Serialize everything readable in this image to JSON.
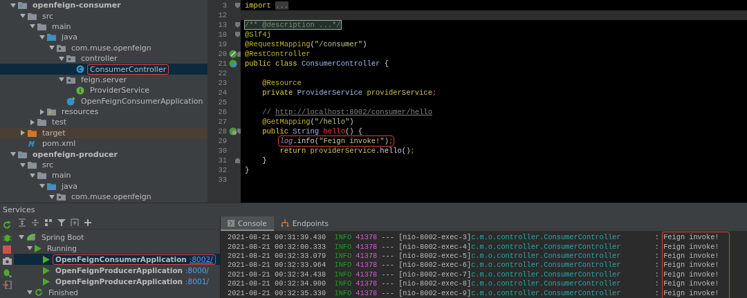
{
  "project_tree": [
    {
      "label": "openfeign-consumer",
      "kind": "module",
      "expanded": true,
      "selected": false,
      "highlighted": false,
      "children": [
        {
          "label": "src",
          "kind": "folder",
          "expanded": true,
          "selected": false,
          "highlighted": false,
          "children": [
            {
              "label": "main",
              "kind": "folder",
              "expanded": true,
              "selected": false,
              "highlighted": false,
              "children": [
                {
                  "label": "java",
                  "kind": "source-folder",
                  "expanded": true,
                  "selected": false,
                  "highlighted": false,
                  "children": [
                    {
                      "label": "com.muse.openfeign",
                      "kind": "package",
                      "expanded": true,
                      "selected": false,
                      "highlighted": false,
                      "children": [
                        {
                          "label": "controller",
                          "kind": "package",
                          "expanded": true,
                          "selected": false,
                          "highlighted": false,
                          "children": [
                            {
                              "label": "ConsumerController",
                              "kind": "class",
                              "selected": true,
                              "highlighted": true
                            }
                          ]
                        },
                        {
                          "label": "feign.server",
                          "kind": "package",
                          "expanded": true,
                          "selected": false,
                          "highlighted": false,
                          "children": [
                            {
                              "label": "ProviderService",
                              "kind": "interface",
                              "selected": false,
                              "highlighted": false
                            }
                          ]
                        },
                        {
                          "label": "OpenFeignConsumerApplication",
                          "kind": "app-class",
                          "selected": false,
                          "highlighted": false
                        }
                      ]
                    }
                  ]
                },
                {
                  "label": "resources",
                  "kind": "resources-folder",
                  "expanded": false,
                  "selected": false,
                  "highlighted": false
                }
              ]
            },
            {
              "label": "test",
              "kind": "folder",
              "expanded": false,
              "selected": false,
              "highlighted": false
            }
          ]
        },
        {
          "label": "target",
          "kind": "excluded-folder",
          "expanded": false,
          "selected": false,
          "highlighted": false
        },
        {
          "label": "pom.xml",
          "kind": "maven",
          "selected": false,
          "highlighted": false
        }
      ]
    },
    {
      "label": "openfeign-producer",
      "kind": "module",
      "expanded": true,
      "selected": false,
      "highlighted": false,
      "children": [
        {
          "label": "src",
          "kind": "folder",
          "expanded": true,
          "selected": false,
          "highlighted": false,
          "children": [
            {
              "label": "main",
              "kind": "folder",
              "expanded": true,
              "selected": false,
              "highlighted": false,
              "children": [
                {
                  "label": "java",
                  "kind": "source-folder",
                  "expanded": true,
                  "selected": false,
                  "highlighted": false,
                  "children": [
                    {
                      "label": "com.muse.openfeign",
                      "kind": "package",
                      "expanded": true,
                      "selected": false,
                      "highlighted": false
                    }
                  ]
                }
              ]
            }
          ]
        }
      ]
    }
  ],
  "editor": {
    "lines": [
      {
        "number": "3",
        "fold_start": true,
        "tokens": [
          {
            "kind": "keyword",
            "text": "import "
          },
          {
            "kind": "folded",
            "text": "..."
          }
        ]
      },
      {
        "number": "12",
        "band": true
      },
      {
        "number": "13",
        "fold_start": true,
        "tokens": [
          {
            "kind": "folded-comment",
            "text": "/** @description ...*/"
          }
        ]
      },
      {
        "number": "18",
        "fold_start": true,
        "tokens": [
          {
            "kind": "annotation",
            "text": "@Slf4j"
          }
        ]
      },
      {
        "number": "19",
        "tokens": [
          {
            "kind": "annotation",
            "text": "@RequestMapping"
          },
          {
            "kind": "plain",
            "text": "("
          },
          {
            "kind": "string",
            "text": "\"/consumer\""
          },
          {
            "kind": "plain",
            "text": ")"
          }
        ]
      },
      {
        "number": "20",
        "fold_end": true,
        "kind": "bean",
        "tokens": [
          {
            "kind": "annotation",
            "text": "@RestController"
          }
        ]
      },
      {
        "number": "21",
        "kind": "bean-class",
        "tokens": [
          {
            "kind": "keyword",
            "text": "public class "
          },
          {
            "kind": "type",
            "text": "ConsumerController "
          },
          {
            "kind": "plain",
            "text": "{"
          }
        ]
      },
      {
        "number": "22"
      },
      {
        "number": "23",
        "tokens": [
          {
            "kind": "annotation",
            "text": "    @Resource"
          }
        ]
      },
      {
        "number": "24",
        "tokens": [
          {
            "kind": "keyword",
            "text": "    private "
          },
          {
            "kind": "type",
            "text": "ProviderService "
          },
          {
            "kind": "field",
            "text": "providerService"
          },
          {
            "kind": "punct",
            "text": ";"
          }
        ]
      },
      {
        "number": "25"
      },
      {
        "number": "26",
        "tokens": [
          {
            "kind": "comment",
            "text": "    // "
          },
          {
            "kind": "link",
            "text": "http://localhost:8002/consumer/hello"
          }
        ]
      },
      {
        "number": "27",
        "tokens": [
          {
            "kind": "annotation",
            "text": "    @GetMapping"
          },
          {
            "kind": "plain",
            "text": "("
          },
          {
            "kind": "string",
            "text": "\"/hello\""
          },
          {
            "kind": "plain",
            "text": ")"
          }
        ]
      },
      {
        "number": "28",
        "fold_start": true,
        "kind": "bean-web",
        "tokens": [
          {
            "kind": "keyword",
            "text": "    public "
          },
          {
            "kind": "type",
            "text": "String "
          },
          {
            "kind": "method",
            "text": "hello"
          },
          {
            "kind": "plain",
            "text": "() {"
          }
        ]
      },
      {
        "number": "29",
        "highlighted": true,
        "tokens": [
          {
            "kind": "static",
            "text": "log"
          },
          {
            "kind": "plain",
            "text": ".info("
          },
          {
            "kind": "string",
            "text": "\"Feign invoke!\""
          },
          {
            "kind": "plain",
            "text": ")"
          },
          {
            "kind": "punct",
            "text": ";"
          }
        ]
      },
      {
        "number": "30",
        "tokens": [
          {
            "kind": "keyword",
            "text": "        return "
          },
          {
            "kind": "field",
            "text": "providerService"
          },
          {
            "kind": "plain",
            "text": ".hello()"
          },
          {
            "kind": "punct",
            "text": ";"
          }
        ]
      },
      {
        "number": "31",
        "fold_end": true,
        "tokens": [
          {
            "kind": "plain",
            "text": "    }"
          }
        ]
      },
      {
        "number": "32",
        "tokens": [
          {
            "kind": "plain",
            "text": "}"
          }
        ]
      },
      {
        "number": "33"
      }
    ]
  },
  "services": {
    "title": "Services",
    "tree": [
      {
        "label": "Spring Boot",
        "kind": "group",
        "expanded": true,
        "selected": false,
        "highlighted": false,
        "children": [
          {
            "label": "Running",
            "kind": "running",
            "expanded": true,
            "selected": false,
            "highlighted": false,
            "children": [
              {
                "label": "OpenFeignConsumerApplication",
                "port": ":8002/",
                "kind": "app",
                "selected": true,
                "highlighted": true
              },
              {
                "label": "OpenFeignProducerApplication",
                "port": ":8000/",
                "kind": "app",
                "selected": false,
                "highlighted": false
              },
              {
                "label": "OpenFeignProducerApplication",
                "port": ":8001/",
                "kind": "app",
                "selected": false,
                "highlighted": false
              }
            ]
          },
          {
            "label": "Finished",
            "kind": "finished",
            "expanded": true,
            "selected": false,
            "highlighted": false
          }
        ]
      }
    ],
    "tabs": [
      {
        "label": "Console",
        "kind": "console",
        "selected": true
      },
      {
        "label": "Endpoints",
        "kind": "endpoints",
        "selected": false
      }
    ],
    "messages_highlighted": true,
    "log": [
      {
        "time": "2021-08-21 00:31:39.430",
        "level": "INFO",
        "pid": "41378",
        "sep": "---",
        "thread": "[nio-8002-exec-3]",
        "logger": "c.m.o.controller.ConsumerController",
        "colon": ":",
        "message": "Feign invoke!"
      },
      {
        "time": "2021-08-21 00:32:00.333",
        "level": "INFO",
        "pid": "41378",
        "sep": "---",
        "thread": "[nio-8002-exec-4]",
        "logger": "c.m.o.controller.ConsumerController",
        "colon": ":",
        "message": "Feign invoke!"
      },
      {
        "time": "2021-08-21 00:32:33.079",
        "level": "INFO",
        "pid": "41378",
        "sep": "---",
        "thread": "[nio-8002-exec-5]",
        "logger": "c.m.o.controller.ConsumerController",
        "colon": ":",
        "message": "Feign invoke!"
      },
      {
        "time": "2021-08-21 00:32:33.964",
        "level": "INFO",
        "pid": "41378",
        "sep": "---",
        "thread": "[nio-8002-exec-6]",
        "logger": "c.m.o.controller.ConsumerController",
        "colon": ":",
        "message": "Feign invoke!"
      },
      {
        "time": "2021-08-21 00:32:34.438",
        "level": "INFO",
        "pid": "41378",
        "sep": "---",
        "thread": "[nio-8002-exec-7]",
        "logger": "c.m.o.controller.ConsumerController",
        "colon": ":",
        "message": "Feign invoke!"
      },
      {
        "time": "2021-08-21 00:32:34.900",
        "level": "INFO",
        "pid": "41378",
        "sep": "---",
        "thread": "[nio-8002-exec-8]",
        "logger": "c.m.o.controller.ConsumerController",
        "colon": ":",
        "message": "Feign invoke!"
      },
      {
        "time": "2021-08-21 00:32:35.330",
        "level": "INFO",
        "pid": "41378",
        "sep": "---",
        "thread": "[nio-8002-exec-9]",
        "logger": "c.m.o.controller.ConsumerController",
        "colon": ":",
        "message": "Feign invoke!"
      }
    ]
  }
}
